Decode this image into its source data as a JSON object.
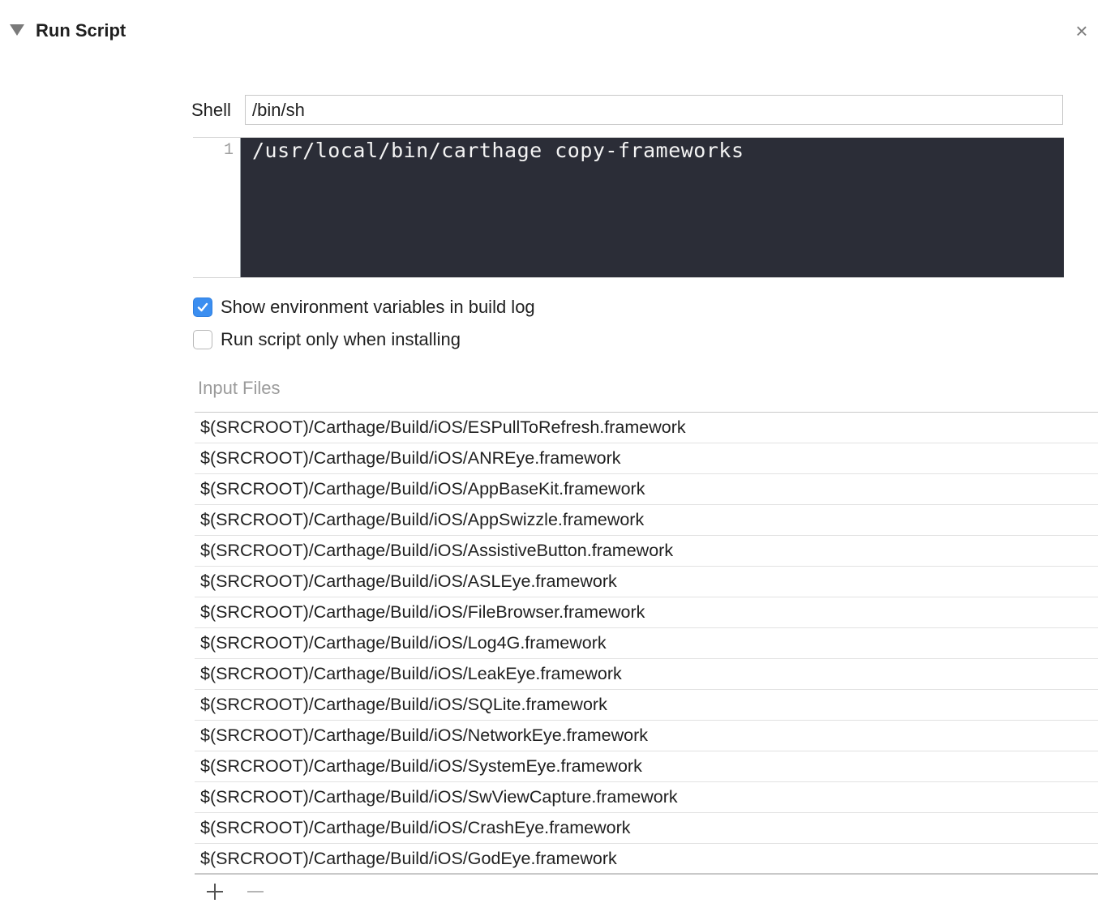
{
  "header": {
    "title": "Run Script",
    "close_glyph": "×"
  },
  "shell": {
    "label": "Shell",
    "value": "/bin/sh"
  },
  "script": {
    "line_number": "1",
    "code": "/usr/local/bin/carthage copy-frameworks"
  },
  "options": {
    "show_env": {
      "label": "Show environment variables in build log",
      "checked": true
    },
    "install_only": {
      "label": "Run script only when installing",
      "checked": false
    }
  },
  "input_files": {
    "label": "Input Files",
    "items": [
      "$(SRCROOT)/Carthage/Build/iOS/ESPullToRefresh.framework",
      "$(SRCROOT)/Carthage/Build/iOS/ANREye.framework",
      "$(SRCROOT)/Carthage/Build/iOS/AppBaseKit.framework",
      "$(SRCROOT)/Carthage/Build/iOS/AppSwizzle.framework",
      "$(SRCROOT)/Carthage/Build/iOS/AssistiveButton.framework",
      "$(SRCROOT)/Carthage/Build/iOS/ASLEye.framework",
      "$(SRCROOT)/Carthage/Build/iOS/FileBrowser.framework",
      "$(SRCROOT)/Carthage/Build/iOS/Log4G.framework",
      "$(SRCROOT)/Carthage/Build/iOS/LeakEye.framework",
      "$(SRCROOT)/Carthage/Build/iOS/SQLite.framework",
      "$(SRCROOT)/Carthage/Build/iOS/NetworkEye.framework",
      "$(SRCROOT)/Carthage/Build/iOS/SystemEye.framework",
      "$(SRCROOT)/Carthage/Build/iOS/SwViewCapture.framework",
      "$(SRCROOT)/Carthage/Build/iOS/CrashEye.framework",
      "$(SRCROOT)/Carthage/Build/iOS/GodEye.framework"
    ]
  },
  "toolbar": {
    "add_icon": "plus-icon",
    "remove_icon": "minus-icon"
  },
  "colors": {
    "editor_bg": "#2b2d37",
    "checkbox_accent": "#3b8ef0"
  }
}
